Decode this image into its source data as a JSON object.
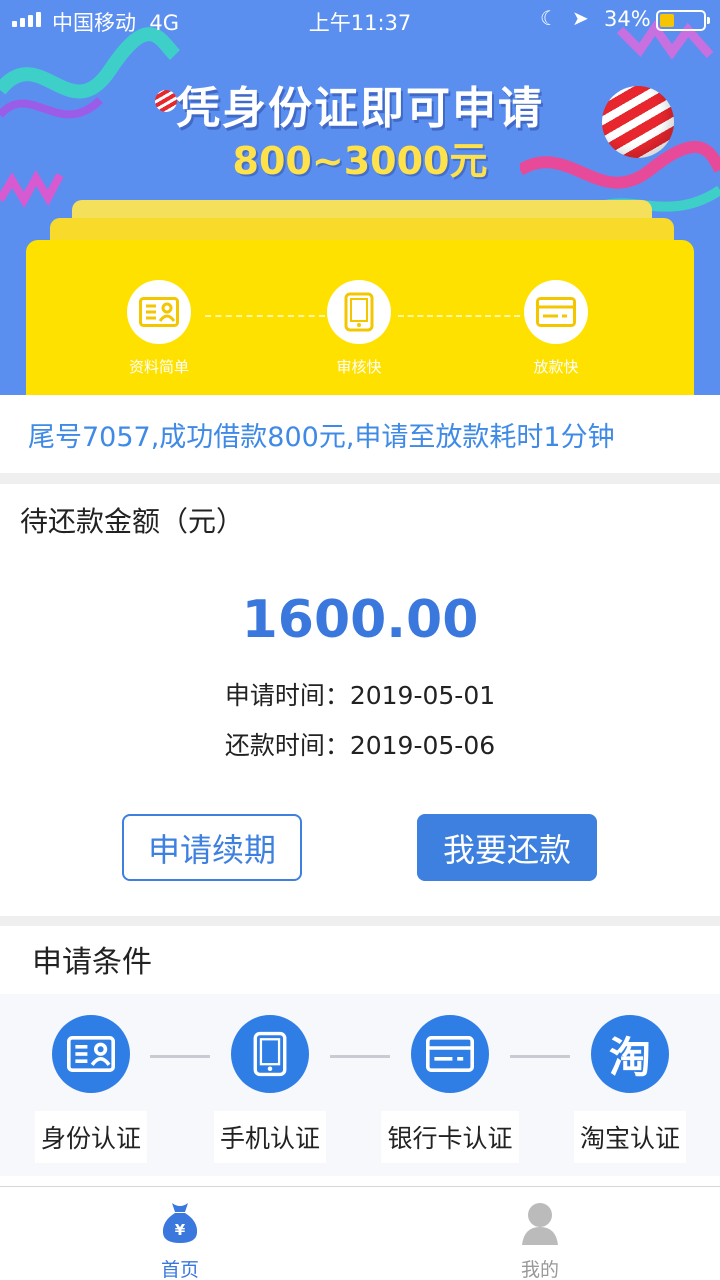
{
  "status_bar": {
    "carrier": "中国移动",
    "network": "4G",
    "time": "上午11:37",
    "battery_text": "34%",
    "battery_level": 0.34,
    "icons": [
      "signal-icon",
      "moon-icon",
      "location-icon",
      "battery-icon"
    ]
  },
  "banner": {
    "title": "凭身份证即可申请",
    "amount": "800~3000元",
    "steps": [
      {
        "label": "资料简单",
        "icon": "id-card-icon"
      },
      {
        "label": "审核快",
        "icon": "phone-icon"
      },
      {
        "label": "放款快",
        "icon": "bank-card-icon"
      }
    ]
  },
  "ticker": {
    "text": "尾号7057,成功借款800元,申请至放款耗时1分钟"
  },
  "repayment": {
    "title": "待还款金额（元）",
    "amount": "1600.00",
    "apply_date": "申请时间：2019-05-01",
    "due_date": "还款时间：2019-05-06",
    "renew_button": "申请续期",
    "pay_button": "我要还款"
  },
  "conditions": {
    "title": "申请条件",
    "items": [
      {
        "label": "身份认证",
        "icon": "id-card-icon"
      },
      {
        "label": "手机认证",
        "icon": "phone-icon"
      },
      {
        "label": "银行卡认证",
        "icon": "bank-card-icon"
      },
      {
        "label": "淘宝认证",
        "icon": "taobao-icon",
        "glyph": "淘"
      }
    ]
  },
  "tabbar": {
    "home": "首页",
    "mine": "我的",
    "active": "home"
  },
  "colors": {
    "primary": "#3d80e0",
    "banner_bg": "#5a8ff0",
    "card_yellow": "#ffe100",
    "ticker_text": "#3f8ae6",
    "tab_active": "#3a78dd",
    "tab_inactive": "#999999"
  }
}
